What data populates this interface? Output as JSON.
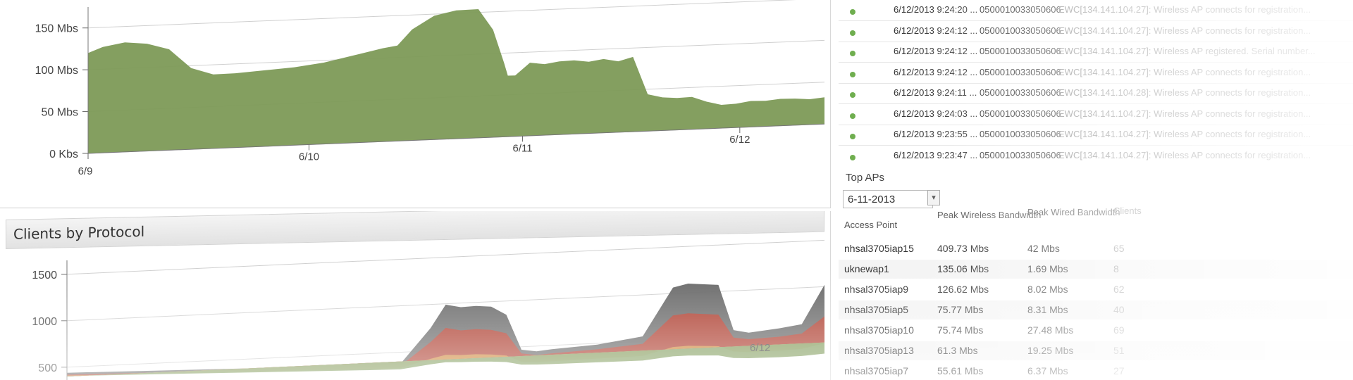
{
  "colors": {
    "bandwidth_fill": "#7d9a57",
    "protocol_series": [
      "#5f5f5f",
      "#b13a2a",
      "#d08a3a",
      "#7d9a57"
    ],
    "status_green": "#6fae4f"
  },
  "bandwidth_chart": {
    "chart_data": {
      "type": "area",
      "title": "",
      "xlabel": "",
      "ylabel": "",
      "y_ticks": [
        "0 Kbs",
        "50 Mbs",
        "100 Mbs",
        "150 Mbs"
      ],
      "y_tick_values": [
        0,
        50,
        100,
        150
      ],
      "x_ticks": [
        "6/9",
        "6/10",
        "6/11",
        "6/12"
      ],
      "ylim": [
        0,
        175
      ],
      "grid": true,
      "series": [
        {
          "x": [
            0,
            0.02,
            0.05,
            0.08,
            0.11,
            0.14,
            0.17,
            0.2,
            0.24,
            0.28,
            0.32,
            0.36,
            0.4,
            0.42,
            0.44,
            0.47,
            0.5,
            0.53,
            0.55,
            0.565,
            0.57,
            0.58,
            0.6,
            0.62,
            0.64,
            0.66,
            0.68,
            0.7,
            0.72,
            0.74,
            0.76,
            0.78,
            0.8,
            0.82,
            0.84,
            0.86,
            0.88,
            0.9,
            0.92,
            0.94,
            0.96,
            0.98,
            1.0
          ],
          "values": [
            120,
            127,
            132,
            130,
            123,
            100,
            92,
            93,
            96,
            99,
            104,
            112,
            120,
            123,
            142,
            158,
            164,
            165,
            140,
            100,
            85,
            85,
            100,
            98,
            101,
            102,
            100,
            103,
            100,
            105,
            60,
            56,
            55,
            56,
            50,
            46,
            47,
            50,
            50,
            52,
            52,
            51,
            53
          ]
        }
      ]
    }
  },
  "protocol_chart": {
    "title": "Clients by Protocol",
    "chart_data": {
      "type": "area",
      "title": "Clients by Protocol",
      "y_ticks": [
        "500",
        "1000",
        "1500"
      ],
      "y_tick_values": [
        500,
        1000,
        1500
      ],
      "x_ticks": [
        "6/12"
      ],
      "ylim": [
        400,
        1650
      ],
      "grid": true,
      "series": [
        {
          "name": "",
          "x": [
            0,
            0.2,
            0.4,
            0.44,
            0.48,
            0.5,
            0.52,
            0.54,
            0.56,
            0.58,
            0.6,
            0.62,
            0.64,
            0.7,
            0.76,
            0.8,
            0.82,
            0.86,
            0.88,
            0.9,
            0.94,
            0.97,
            1.0
          ],
          "values": [
            440,
            450,
            460,
            470,
            850,
            1100,
            1070,
            1080,
            1070,
            980,
            600,
            580,
            600,
            640,
            720,
            1240,
            1280,
            1260,
            770,
            740,
            780,
            820,
            1240
          ]
        },
        {
          "name": "",
          "x": [
            0,
            0.2,
            0.4,
            0.44,
            0.48,
            0.5,
            0.52,
            0.54,
            0.56,
            0.58,
            0.6,
            0.62,
            0.64,
            0.7,
            0.76,
            0.8,
            0.82,
            0.86,
            0.88,
            0.9,
            0.94,
            0.97,
            1.0
          ],
          "values": [
            420,
            430,
            440,
            450,
            700,
            850,
            820,
            830,
            820,
            780,
            560,
            540,
            555,
            590,
            640,
            940,
            960,
            940,
            690,
            670,
            690,
            720,
            900
          ]
        },
        {
          "name": "",
          "x": [
            0,
            0.2,
            0.4,
            0.44,
            0.48,
            0.5,
            0.52,
            0.54,
            0.56,
            0.58,
            0.6,
            0.62,
            0.64,
            0.7,
            0.76,
            0.8,
            0.82,
            0.86,
            0.88,
            0.9,
            0.94,
            0.97,
            1.0
          ],
          "values": [
            410,
            415,
            420,
            425,
            520,
            560,
            555,
            560,
            555,
            540,
            470,
            465,
            470,
            490,
            510,
            600,
            610,
            600,
            540,
            530,
            540,
            555,
            610
          ]
        },
        {
          "name": "",
          "x": [
            0,
            0.2,
            0.4,
            0.44,
            0.48,
            0.5,
            0.52,
            0.54,
            0.56,
            0.58,
            0.6,
            0.62,
            0.64,
            0.7,
            0.76,
            0.8,
            0.82,
            0.86,
            0.88,
            0.9,
            0.94,
            0.97,
            1.0
          ],
          "values": [
            405,
            408,
            410,
            412,
            460,
            480,
            478,
            480,
            478,
            470,
            440,
            438,
            440,
            450,
            460,
            500,
            505,
            500,
            470,
            465,
            470,
            478,
            500
          ]
        }
      ]
    }
  },
  "event_log": {
    "rows": [
      {
        "time": "6/12/2013 9:24:20 ...",
        "serial": "0500010033050606",
        "message": "EWC[134.141.104.27]: Wireless AP connects for registration..."
      },
      {
        "time": "6/12/2013 9:24:12 ...",
        "serial": "0500010033050606",
        "message": "EWC[134.141.104.27]: Wireless AP connects for registration..."
      },
      {
        "time": "6/12/2013 9:24:12 ...",
        "serial": "0500010033050606",
        "message": "EWC[134.141.104.27]: Wireless AP registered. Serial number..."
      },
      {
        "time": "6/12/2013 9:24:12 ...",
        "serial": "0500010033050606",
        "message": "EWC[134.141.104.27]: Wireless AP connects for registration..."
      },
      {
        "time": "6/12/2013 9:24:11 ...",
        "serial": "0500010033050606",
        "message": "EWC[134.141.104.28]: Wireless AP connects for registration..."
      },
      {
        "time": "6/12/2013 9:24:03 ...",
        "serial": "0500010033050606",
        "message": "EWC[134.141.104.27]: Wireless AP connects for registration..."
      },
      {
        "time": "6/12/2013 9:23:55 ...",
        "serial": "0500010033050606",
        "message": "EWC[134.141.104.27]: Wireless AP connects for registration..."
      },
      {
        "time": "6/12/2013 9:23:47 ...",
        "serial": "0500010033050606",
        "message": "EWC[134.141.104.27]: Wireless AP connects for registration..."
      }
    ]
  },
  "top_aps": {
    "title": "Top APs",
    "date_value": "6-11-2013",
    "date_button": "▾",
    "columns": {
      "access_point": "Access Point",
      "peak_wireless": "Peak Wireless Bandwidth",
      "peak_wired": "Peak Wired Bandwidth",
      "clients": "Clients"
    },
    "rows": [
      {
        "name": "nhsal3705iap15",
        "wireless": "409.73 Mbs",
        "wired": "42 Mbs",
        "clients": "65"
      },
      {
        "name": "uknewap1",
        "wireless": "135.06 Mbs",
        "wired": "1.69 Mbs",
        "clients": "8"
      },
      {
        "name": "nhsal3705iap9",
        "wireless": "126.62 Mbs",
        "wired": "8.02 Mbs",
        "clients": "62"
      },
      {
        "name": "nhsal3705iap5",
        "wireless": "75.77 Mbs",
        "wired": "8.31 Mbs",
        "clients": "40"
      },
      {
        "name": "nhsal3705iap10",
        "wireless": "75.74 Mbs",
        "wired": "27.48 Mbs",
        "clients": "69"
      },
      {
        "name": "nhsal3705iap13",
        "wireless": "61.3 Mbs",
        "wired": "19.25 Mbs",
        "clients": "51"
      },
      {
        "name": "nhsal3705iap7",
        "wireless": "55.61 Mbs",
        "wired": "6.37 Mbs",
        "clients": "27"
      }
    ]
  }
}
